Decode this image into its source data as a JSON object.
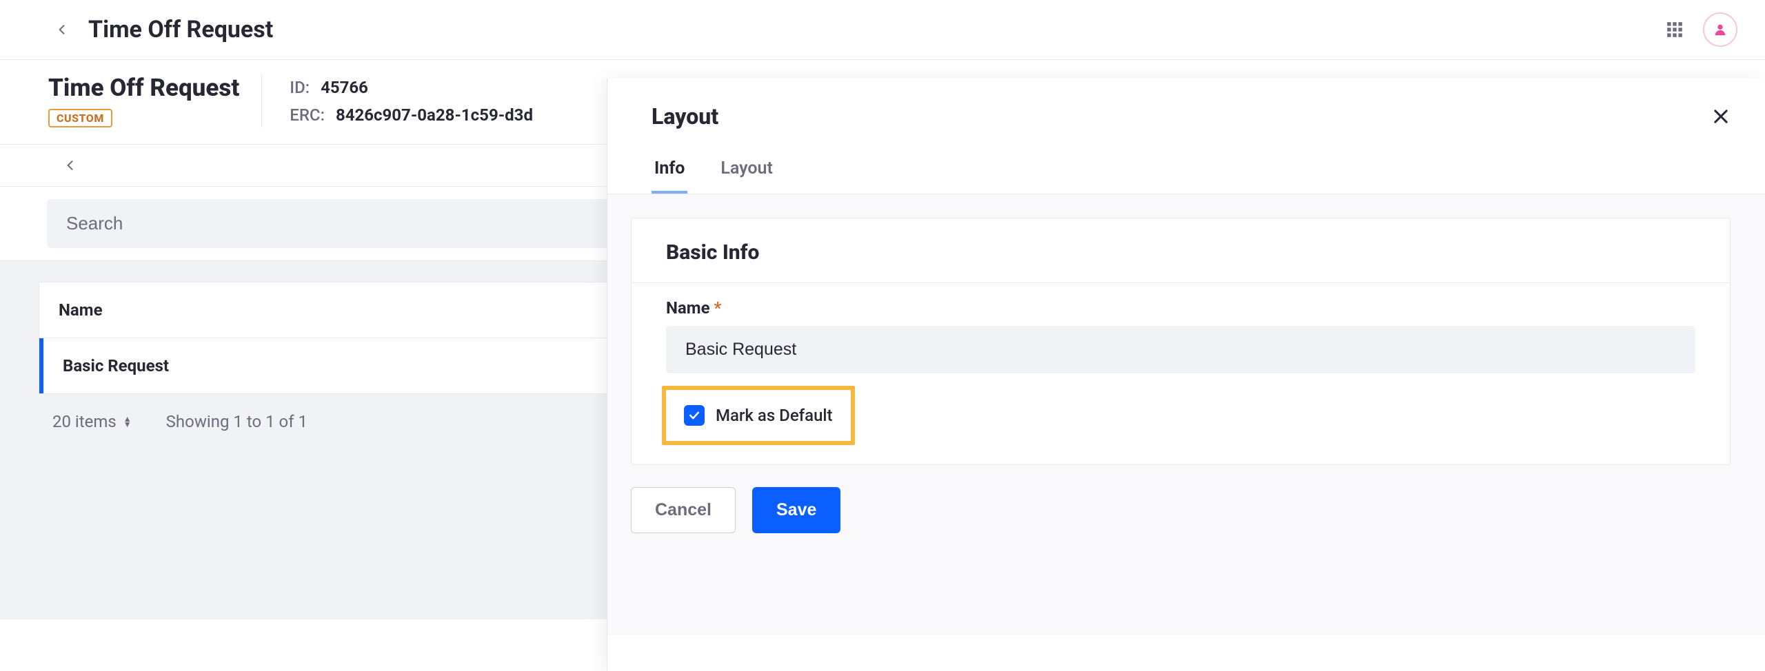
{
  "topbar": {
    "title": "Time Off Request"
  },
  "object": {
    "title": "Time Off Request",
    "badge": "CUSTOM",
    "id_label": "ID:",
    "id_value": "45766",
    "erc_label": "ERC:",
    "erc_value": "8426c907-0a28-1c59-d3d"
  },
  "search": {
    "placeholder": "Search"
  },
  "table": {
    "header_name": "Name",
    "rows": [
      {
        "name": "Basic Request"
      }
    ]
  },
  "pagination": {
    "items_text": "20 items",
    "showing_text": "Showing 1 to 1 of 1"
  },
  "panel": {
    "title": "Layout",
    "tabs": {
      "info": "Info",
      "layout": "Layout"
    },
    "section_title": "Basic Info",
    "name_label": "Name",
    "name_value": "Basic Request",
    "default_label": "Mark as Default",
    "default_checked": true,
    "cancel": "Cancel",
    "save": "Save"
  }
}
